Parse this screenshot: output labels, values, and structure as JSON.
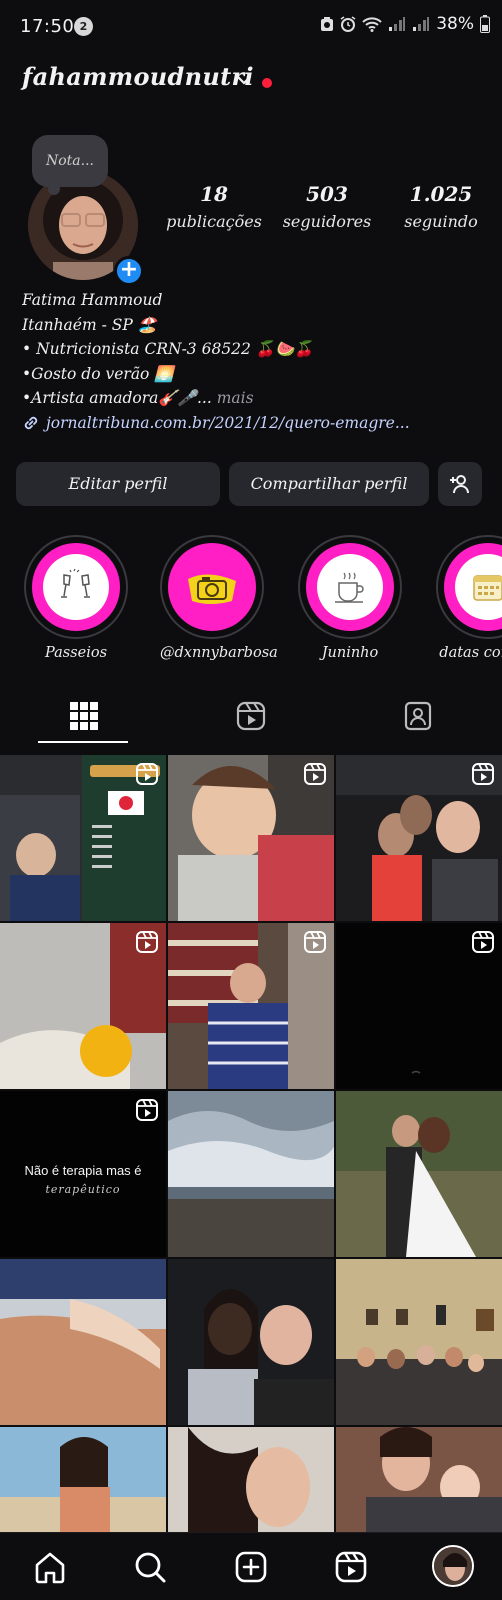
{
  "status_bar": {
    "time": "17:50",
    "notification_count": "2",
    "battery": "38%"
  },
  "header": {
    "username": "fahammoudnutri"
  },
  "profile": {
    "note_placeholder": "Nota...",
    "stats": [
      {
        "number": "18",
        "label": "publicações"
      },
      {
        "number": "503",
        "label": "seguidores"
      },
      {
        "number": "1.025",
        "label": "seguindo"
      }
    ],
    "bio": {
      "name": "Fatima Hammoud",
      "line1": "Itanhaém - SP 🏖️",
      "line2": "• Nutricionista CRN-3 68522 🍒🍉🍒",
      "line3": "•Gosto do verão 🌅",
      "line4": "•Artista amadora🎸🎤...",
      "more": "mais",
      "link": "jornaltribuna.com.br/2021/12/quero-emagre..."
    }
  },
  "buttons": {
    "edit": "Editar perfil",
    "share": "Compartilhar perfil"
  },
  "highlights": [
    {
      "label": "Passeios",
      "icon": "champagne-glasses-icon"
    },
    {
      "label": "@dxnnybarbosa",
      "icon": "camera-icon"
    },
    {
      "label": "Juninho",
      "icon": "coffee-cup-icon"
    },
    {
      "label": "datas comem",
      "icon": "calendar-icon"
    }
  ],
  "tabs": [
    {
      "name": "grid",
      "icon": "grid-icon"
    },
    {
      "name": "reels",
      "icon": "reels-icon"
    },
    {
      "name": "tagged",
      "icon": "tagged-person-icon"
    }
  ],
  "grid": {
    "caption_text": "Não é terapia mas é",
    "caption_script": "terapêutico"
  },
  "colors": {
    "background": "#0d0d10",
    "button": "#26282d",
    "highlight_pink": "#ff1fc4",
    "badge_blue": "#1f8cf5",
    "notification_red": "#ff1f3d"
  }
}
